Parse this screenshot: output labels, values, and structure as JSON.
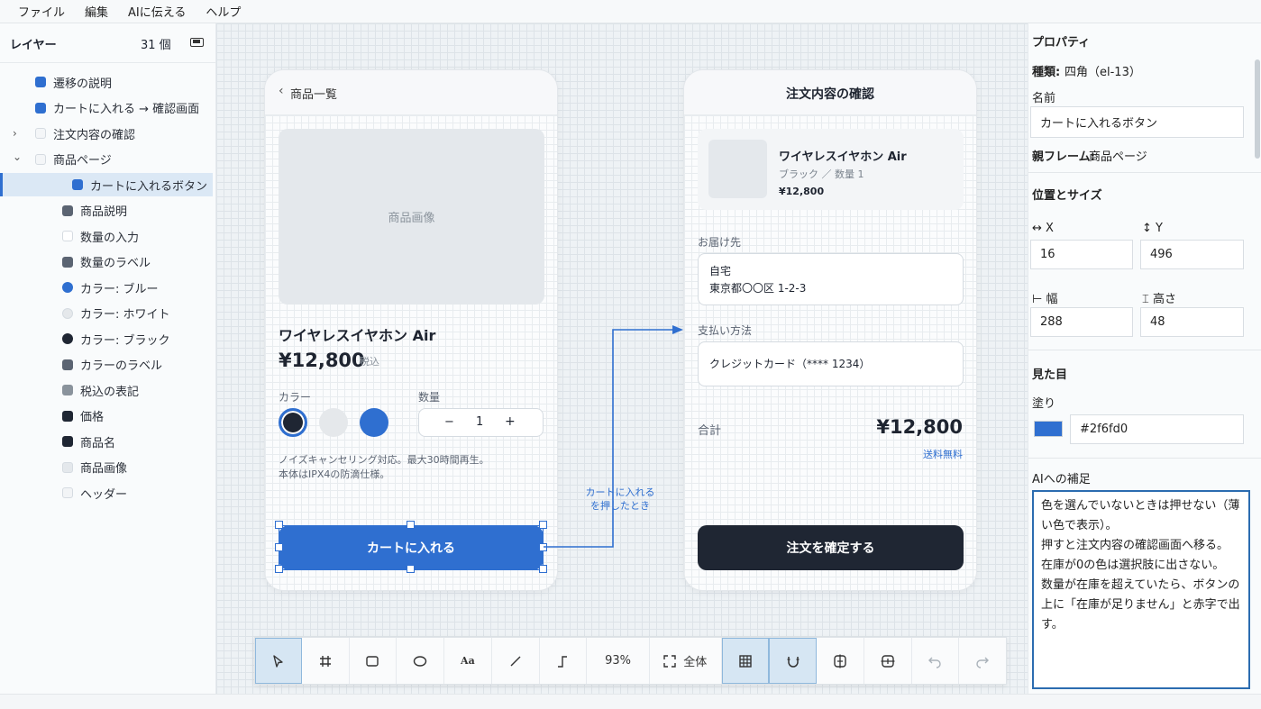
{
  "menu": [
    "ファイル",
    "編集",
    "AIに伝える",
    "ヘルプ"
  ],
  "layers": {
    "title": "レイヤー",
    "count": "31 個",
    "items": [
      {
        "label": "遷移の説明",
        "color": "#2f6fd0",
        "shape": "square",
        "expander": ""
      },
      {
        "label": "カートに入れる → 確認画面",
        "color": "#2f6fd0",
        "shape": "square",
        "expander": ""
      },
      {
        "label": "注文内容の確認",
        "color": "#f4f6f8",
        "shape": "square",
        "expander": ">"
      },
      {
        "label": "商品ページ",
        "color": "#f4f6f8",
        "shape": "square",
        "expander": "v"
      },
      {
        "label": "カートに入れるボタン",
        "color": "#2f6fd0",
        "shape": "square",
        "expander": ""
      },
      {
        "label": "商品説明",
        "color": "#5b6472",
        "shape": "square",
        "expander": ""
      },
      {
        "label": "数量の入力",
        "color": "#ffffff",
        "shape": "square",
        "expander": ""
      },
      {
        "label": "数量のラベル",
        "color": "#5b6472",
        "shape": "square",
        "expander": ""
      },
      {
        "label": "カラー: ブルー",
        "color": "#2f6fd0",
        "shape": "circle",
        "expander": ""
      },
      {
        "label": "カラー: ホワイト",
        "color": "#e5e8eb",
        "shape": "circle",
        "expander": ""
      },
      {
        "label": "カラー: ブラック",
        "color": "#1f2633",
        "shape": "circle",
        "expander": ""
      },
      {
        "label": "カラーのラベル",
        "color": "#5b6472",
        "shape": "square",
        "expander": ""
      },
      {
        "label": "税込の表記",
        "color": "#8a939c",
        "shape": "square",
        "expander": ""
      },
      {
        "label": "価格",
        "color": "#1f2633",
        "shape": "square",
        "expander": ""
      },
      {
        "label": "商品名",
        "color": "#1f2633",
        "shape": "square",
        "expander": ""
      },
      {
        "label": "商品画像",
        "color": "#e4e8ec",
        "shape": "square",
        "expander": ""
      },
      {
        "label": "ヘッダー",
        "color": "#f2f4f6",
        "shape": "square",
        "expander": ""
      }
    ]
  },
  "product_page": {
    "back_label": "‹",
    "header_title": "商品一覧",
    "image_placeholder": "商品画像",
    "product_name": "ワイヤレスイヤホン Air",
    "price": "¥12,800",
    "tax_note": "税込",
    "color_label": "カラー",
    "colors": [
      "#1f2633",
      "#e5e8eb",
      "#2f6fd0"
    ],
    "qty_label": "数量",
    "qty_minus": "−",
    "qty_value": "1",
    "qty_plus": "+",
    "description_line1": "ノイズキャンセリング対応。最大30時間再生。",
    "description_line2": "本体はIPX4の防滴仕様。",
    "add_to_cart": "カートに入れる"
  },
  "connector": {
    "line1": "カートに入れる",
    "line2": "を押したとき"
  },
  "confirm_page": {
    "header_title": "注文内容の確認",
    "item_name": "ワイヤレスイヤホン Air",
    "item_variant": "ブラック ／ 数量 1",
    "item_price": "¥12,800",
    "ship_label": "お届け先",
    "ship_line1": "自宅",
    "ship_line2": "東京都〇〇区 1-2-3",
    "pay_label": "支払い方法",
    "pay_value": "クレジットカード（**** 1234）",
    "total_label": "合計",
    "total_value": "¥12,800",
    "shipping_free": "送料無料",
    "confirm_button": "注文を確定する"
  },
  "toolbar": {
    "zoom": "93%",
    "fit_label": "全体",
    "text_tool": "Aa"
  },
  "properties": {
    "title": "プロパティ",
    "kind_label": "種類:",
    "kind_value": "四角（el-13）",
    "name_label": "名前",
    "name_value": "カートに入れるボタン",
    "parent_label": "親フレーム:",
    "parent_value": "商品ページ",
    "pos_title": "位置とサイズ",
    "x_label": "X",
    "x_value": "16",
    "y_label": "Y",
    "y_value": "496",
    "w_label": "幅",
    "w_value": "288",
    "h_label": "高さ",
    "h_value": "48",
    "appearance_title": "見た目",
    "fill_label": "塗り",
    "fill_color": "#2f6fd0",
    "fill_value": "#2f6fd0",
    "ai_note_label": "AIへの補足",
    "ai_note_text": "色を選んでいないときは押せない（薄い色で表示）。\n押すと注文内容の確認画面へ移る。\n在庫が0の色は選択肢に出さない。\n数量が在庫を超えていたら、ボタンの上に「在庫が足りません」と赤字で出す。"
  }
}
